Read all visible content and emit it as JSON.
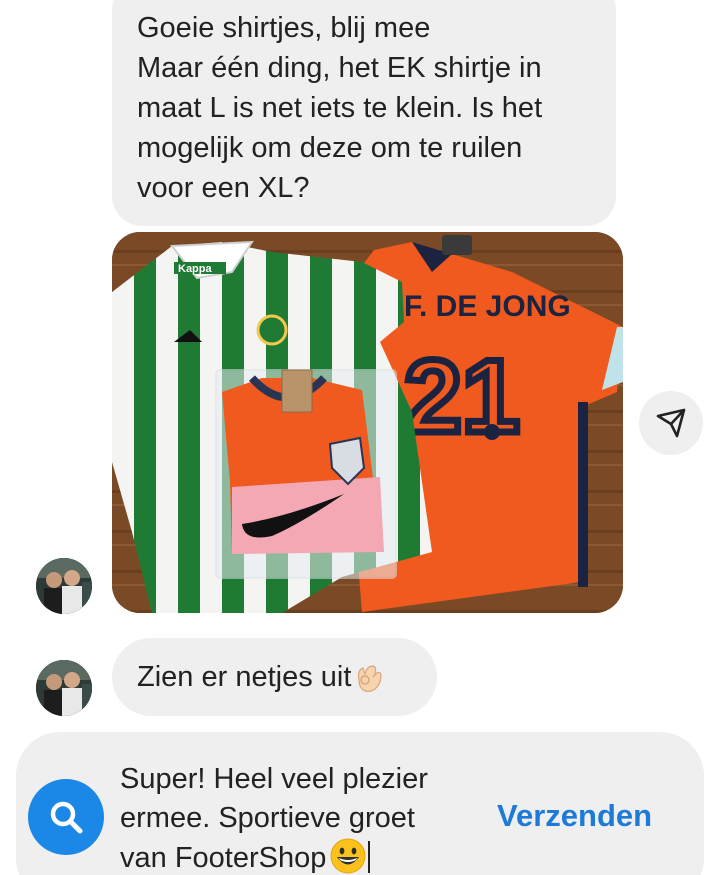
{
  "messages": {
    "first": {
      "lines": [
        "Goeie shirtjes, blij mee",
        "Maar één ding, het EK shirtje in",
        "maat L is net iets te klein. Is het",
        "mogelijk om deze om te ruilen",
        "voor een XL?"
      ]
    },
    "photo": {
      "jersey_brand": "Kappa",
      "player_name": "F. DE JONG",
      "player_number": "21"
    },
    "second": {
      "text": "Zien er netjes uit",
      "emoji": "ok-hand-emoji"
    }
  },
  "composer": {
    "lines": [
      "Super! Heel veel plezier",
      "ermee. Sportieve groet",
      "van FooterShop"
    ],
    "emoji": "grinning-face-emoji",
    "send_label": "Verzenden"
  },
  "colors": {
    "bubble": "#efefef",
    "accent": "#1d7ad9",
    "search_button": "#1b87e6"
  }
}
